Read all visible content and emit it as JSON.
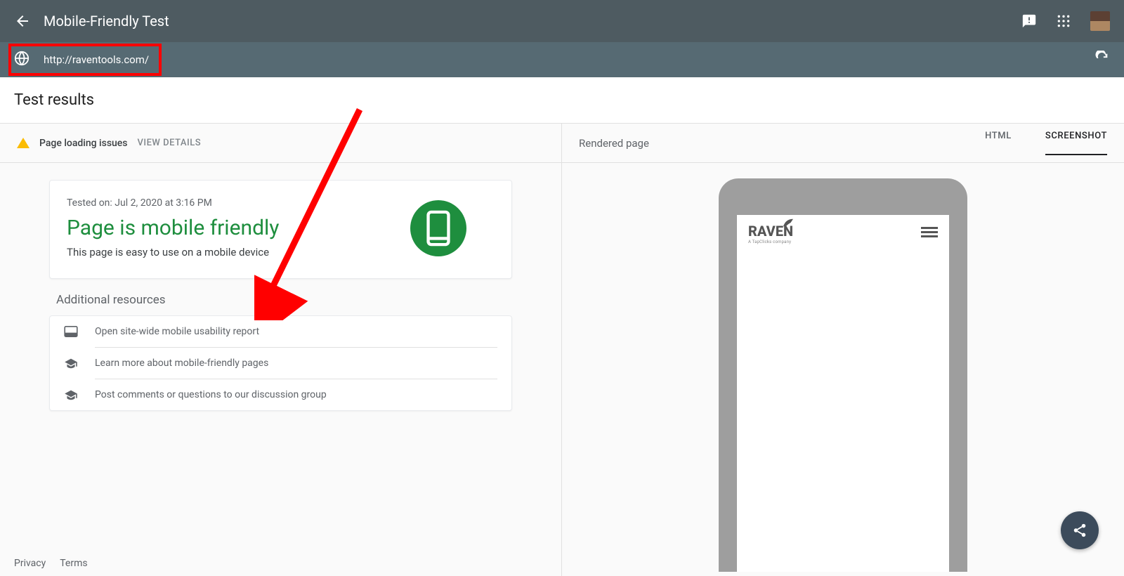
{
  "header": {
    "title": "Mobile-Friendly Test"
  },
  "url": "http://raventools.com/",
  "results_heading": "Test results",
  "issues": {
    "label": "Page loading issues",
    "view": "VIEW DETAILS"
  },
  "result": {
    "tested": "Tested on: Jul 2, 2020 at 3:16 PM",
    "title": "Page is mobile friendly",
    "subtitle": "This page is easy to use on a mobile device"
  },
  "additional": {
    "heading": "Additional resources",
    "items": [
      "Open site-wide mobile usability report",
      "Learn more about mobile-friendly pages",
      "Post comments or questions to our discussion group"
    ]
  },
  "right": {
    "rendered": "Rendered page",
    "tabs": {
      "html": "HTML",
      "screenshot": "SCREENSHOT"
    }
  },
  "phone": {
    "logo": "RAVEN",
    "tag": "A TapClicks company"
  },
  "footer": {
    "privacy": "Privacy",
    "terms": "Terms"
  }
}
